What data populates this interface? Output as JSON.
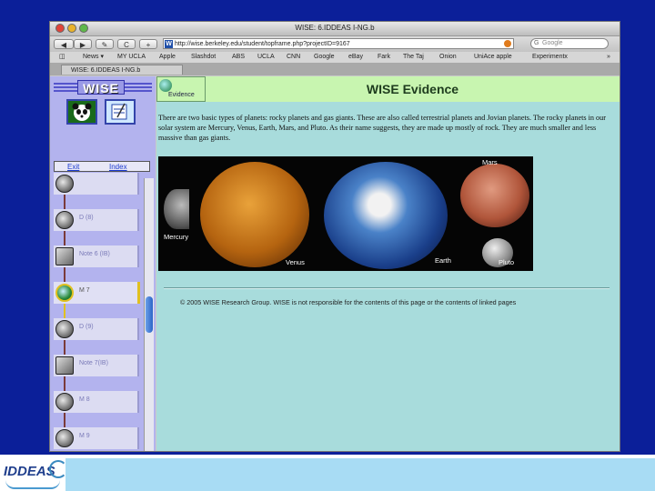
{
  "window": {
    "title": "WISE: 6.IDDEAS I-NG.b"
  },
  "toolbar": {
    "back_label": "◀",
    "forward_label": "▶",
    "edit_label": "✎",
    "reload_label": "C",
    "add_label": "+",
    "url": "http://wise.berkeley.edu/student/topframe.php?projectID=9167",
    "search_placeholder": "Google"
  },
  "bookmarks": [
    "News ▾",
    "MY UCLA",
    "Apple",
    "Slashdot",
    "ABS",
    "UCLA",
    "CNN",
    "Google",
    "eBay",
    "Fark",
    "The Taj",
    "Onion",
    "UniAce apple",
    "Experimentx"
  ],
  "tab": {
    "label": "WISE: 6.IDDEAS I-NG.b"
  },
  "sidebar": {
    "logo": "WISE",
    "exit_label": "Exit",
    "index_label": "Index",
    "steps": [
      {
        "label": "",
        "kind": "globe"
      },
      {
        "label": "D (8)",
        "kind": "globe"
      },
      {
        "label": "Note 6 (IB)",
        "kind": "note"
      },
      {
        "label": "M 7",
        "kind": "globe",
        "active": true
      },
      {
        "label": "D (9)",
        "kind": "globe"
      },
      {
        "label": "Note 7(IB)",
        "kind": "note"
      },
      {
        "label": "M 8",
        "kind": "globe"
      },
      {
        "label": "M 9",
        "kind": "globe"
      }
    ]
  },
  "content": {
    "evidence_tab": "Evidence",
    "title": "WISE Evidence",
    "body": "There are two basic types of planets: rocky planets and gas giants. These are also called terrestrial planets and Jovian planets. The rocky planets in our solar system are Mercury, Venus, Earth, Mars, and Pluto. As their name suggests, they are made up mostly of rock. They are much smaller and less massive than gas giants.",
    "planet_labels": {
      "mercury": "Mercury",
      "venus": "Venus",
      "earth": "Earth",
      "mars": "Mars",
      "pluto": "Pluto"
    },
    "footer": "© 2005 WISE Research Group. WISE is not responsible for the contents of this page or the contents of linked pages"
  },
  "slide": {
    "logo_text": "IDDEAS"
  }
}
